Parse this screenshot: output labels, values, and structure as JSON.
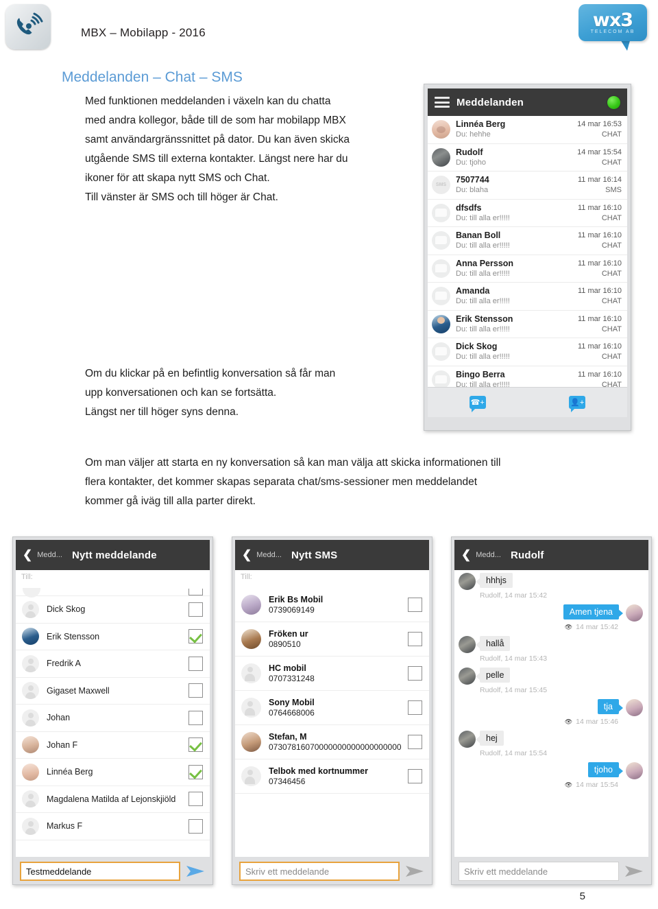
{
  "header": {
    "app_icon": "phone-ring-icon",
    "doc_title": "MBX – Mobilapp - 2016",
    "logo": {
      "main": "wx3",
      "sub": "TELECOM AB"
    }
  },
  "section": {
    "title": "Meddelanden – Chat – SMS",
    "paragraph_1": [
      "Med funktionen meddelanden i växeln kan du chatta",
      "med andra kollegor, både till de som har mobilapp MBX",
      "samt användargränssnittet på dator. Du kan även skicka",
      "utgående SMS till externa kontakter. Längst nere har du",
      "ikoner för att skapa nytt SMS och Chat.",
      "Till vänster är SMS och till höger är Chat."
    ],
    "paragraph_2": [
      "Om du klickar på en befintlig konversation så får man",
      "upp konversationen och kan se fortsätta.",
      "Längst ner till höger syns denna."
    ],
    "paragraph_3": [
      "Om man väljer att starta en ny konversation så kan man välja att skicka informationen till",
      "flera kontakter, det kommer skapas separata chat/sms-sessioner men meddelandet",
      "kommer gå iväg till alla parter direkt."
    ]
  },
  "page_number": "5",
  "phone_messages": {
    "bar": {
      "menu_icon": "hamburger-icon",
      "title": "Meddelanden",
      "status_icon": "online-status-dot"
    },
    "conversations": [
      {
        "name": "Linnéa Berg",
        "preview": "Du: hehhe",
        "time": "14 mar 16:53",
        "type": "CHAT",
        "avatar": "photo-linnea"
      },
      {
        "name": "Rudolf",
        "preview": "Du: tjoho",
        "time": "14 mar 15:54",
        "type": "CHAT",
        "avatar": "photo-rudolf"
      },
      {
        "name": "7507744",
        "preview": "Du: blaha",
        "time": "11 mar 16:14",
        "type": "SMS",
        "avatar": "sms-badge"
      },
      {
        "name": "dfsdfs",
        "preview": "Du: till alla er!!!!!",
        "time": "11 mar 16:10",
        "type": "CHAT",
        "avatar": "placeholder"
      },
      {
        "name": "Banan Boll",
        "preview": "Du: till alla er!!!!!",
        "time": "11 mar 16:10",
        "type": "CHAT",
        "avatar": "placeholder"
      },
      {
        "name": "Anna Persson",
        "preview": "Du: till alla er!!!!!",
        "time": "11 mar 16:10",
        "type": "CHAT",
        "avatar": "placeholder"
      },
      {
        "name": "Amanda",
        "preview": "Du: till alla er!!!!!",
        "time": "11 mar 16:10",
        "type": "CHAT",
        "avatar": "placeholder"
      },
      {
        "name": "Erik Stensson",
        "preview": "Du: till alla er!!!!!",
        "time": "11 mar 16:10",
        "type": "CHAT",
        "avatar": "photo-erik"
      },
      {
        "name": "Dick Skog",
        "preview": "Du: till alla er!!!!!",
        "time": "11 mar 16:10",
        "type": "CHAT",
        "avatar": "placeholder"
      },
      {
        "name": "Bingo Berra",
        "preview": "Du: till alla er!!!!!",
        "time": "11 mar 16:10",
        "type": "CHAT",
        "avatar": "placeholder"
      }
    ],
    "footer": {
      "left_icon": "new-sms-icon",
      "right_icon": "new-chat-icon"
    }
  },
  "phone_new_message": {
    "bar": {
      "back_icon": "back-chevron-icon",
      "back_label": "Medd...",
      "title": "Nytt meddelande"
    },
    "to_label": "Till:",
    "contacts": [
      {
        "name": "Dick Skog",
        "checked": false,
        "avatar": "placeholder"
      },
      {
        "name": "Erik Stensson",
        "checked": true,
        "avatar": "photo-erik"
      },
      {
        "name": "Fredrik A",
        "checked": false,
        "avatar": "placeholder"
      },
      {
        "name": "Gigaset Maxwell",
        "checked": false,
        "avatar": "placeholder"
      },
      {
        "name": "Johan",
        "checked": false,
        "avatar": "placeholder"
      },
      {
        "name": "Johan F",
        "checked": true,
        "avatar": "photo-johan"
      },
      {
        "name": "Linnéa Berg",
        "checked": true,
        "avatar": "photo-linnea"
      },
      {
        "name": "Magdalena Matilda af Lejonskjiöld",
        "checked": false,
        "avatar": "placeholder"
      },
      {
        "name": "Markus F",
        "checked": false,
        "avatar": "placeholder"
      }
    ],
    "compose": {
      "value": "Testmeddelande",
      "send_icon": "send-arrow-icon"
    }
  },
  "phone_new_sms": {
    "bar": {
      "back_icon": "back-chevron-icon",
      "back_label": "Medd...",
      "title": "Nytt SMS"
    },
    "to_label": "Till:",
    "contacts": [
      {
        "name": "Erik Bs Mobil",
        "number": "0739069149",
        "checked": false,
        "avatar": "photo-erikbs"
      },
      {
        "name": "Fröken ur",
        "number": "0890510",
        "checked": false,
        "avatar": "photo-froken"
      },
      {
        "name": "HC mobil",
        "number": "0707331248",
        "checked": false,
        "avatar": "placeholder"
      },
      {
        "name": "Sony Mobil",
        "number": "0764668006",
        "checked": false,
        "avatar": "placeholder"
      },
      {
        "name": "Stefan, M",
        "number": "07307816070000000000000000000",
        "checked": false,
        "avatar": "photo-stefan"
      },
      {
        "name": "Telbok med kortnummer",
        "number": "07346456",
        "checked": false,
        "avatar": "placeholder"
      }
    ],
    "compose": {
      "placeholder": "Skriv ett meddelande",
      "send_icon": "send-arrow-icon"
    }
  },
  "phone_rudolf": {
    "bar": {
      "back_icon": "back-chevron-icon",
      "back_label": "Medd...",
      "title": "Rudolf"
    },
    "messages": [
      {
        "dir": "in",
        "text": "hhhjs",
        "meta": "Rudolf, 14 mar 15:42"
      },
      {
        "dir": "out",
        "text": "Amen tjena",
        "meta": "14 mar 15:42"
      },
      {
        "dir": "in",
        "text": "hallå",
        "meta": "Rudolf, 14 mar 15:43"
      },
      {
        "dir": "in",
        "text": "pelle",
        "meta": "Rudolf, 14 mar 15:45"
      },
      {
        "dir": "out",
        "text": "tja",
        "meta": "14 mar 15:46"
      },
      {
        "dir": "in",
        "text": "hej",
        "meta": "Rudolf, 14 mar 15:54"
      },
      {
        "dir": "out",
        "text": "tjoho",
        "meta": "14 mar 15:54"
      }
    ],
    "compose": {
      "placeholder": "Skriv ett meddelande",
      "send_icon": "send-arrow-icon"
    }
  },
  "colors": {
    "accent_blue": "#5b9bd5",
    "bubble_blue": "#2fa8e8",
    "bar_dark": "#3a3a3a",
    "check_green": "#77c043",
    "focus_orange": "#e8a33d",
    "status_green": "#36c716"
  }
}
